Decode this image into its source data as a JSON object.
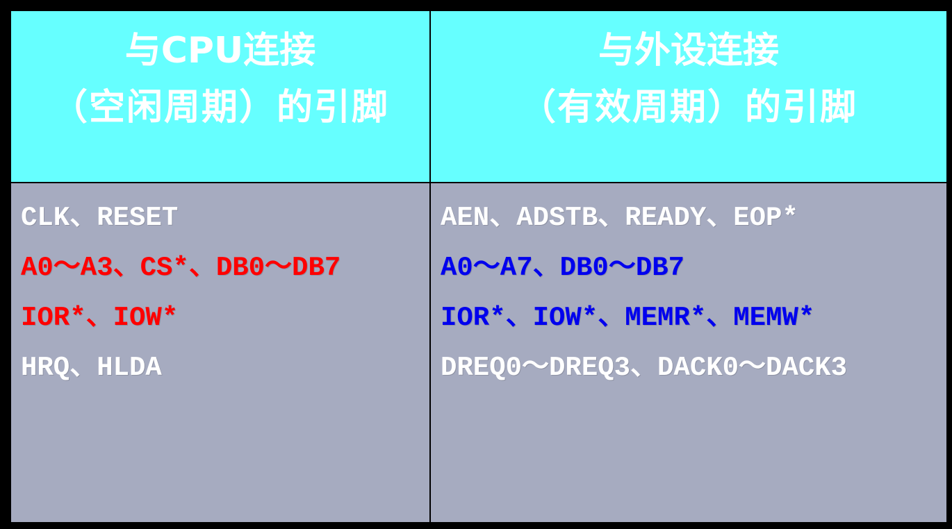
{
  "colors": {
    "background": "#000000",
    "header_bg": "#66FFFF",
    "body_bg": "#A6ABC0",
    "header_text": "#FFFFFF",
    "white": "#FFFFFF",
    "red": "#FF0000",
    "blue": "#0000EE"
  },
  "left": {
    "header_line1": "与CPU连接",
    "header_line2": "（空闲周期）的引脚",
    "rows": [
      {
        "text": "CLK、RESET",
        "color": "white"
      },
      {
        "text": "A0～A3、CS*、DB0～DB7",
        "color": "red"
      },
      {
        "text": "IOR*、IOW*",
        "color": "red"
      },
      {
        "text": "HRQ、HLDA",
        "color": "white"
      }
    ]
  },
  "right": {
    "header_line1": "与外设连接",
    "header_line2": "（有效周期）的引脚",
    "rows": [
      {
        "text": "AEN、ADSTB、READY、EOP*",
        "color": "white"
      },
      {
        "text": "A0～A7、DB0～DB7",
        "color": "blue"
      },
      {
        "text": "IOR*、IOW*、MEMR*、MEMW*",
        "color": "blue"
      },
      {
        "text": "DREQ0～DREQ3、DACK0～DACK3",
        "color": "white"
      }
    ]
  }
}
